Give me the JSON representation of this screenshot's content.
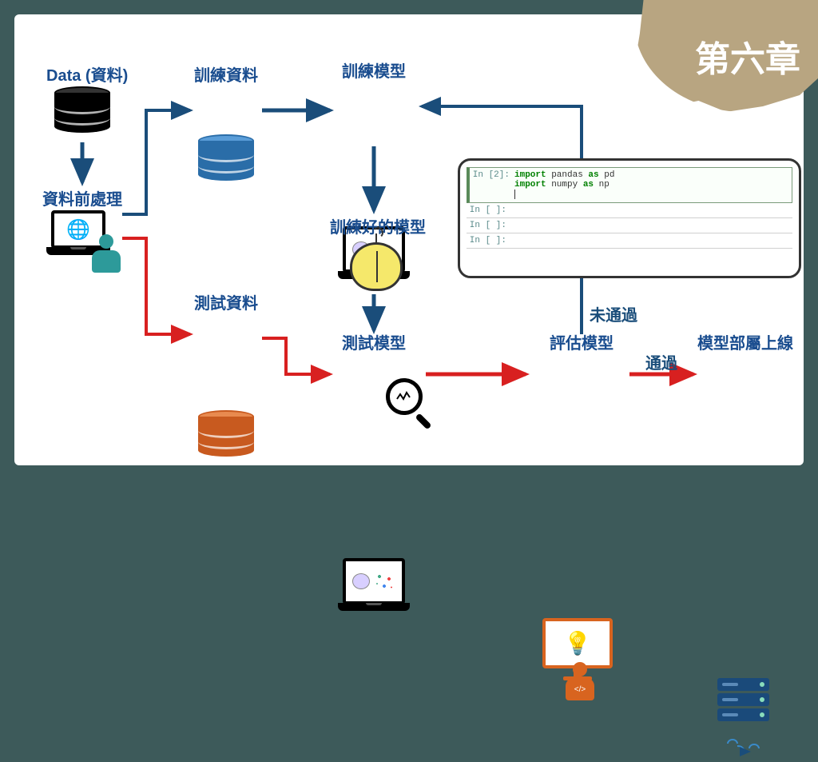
{
  "chapter": "第六章",
  "nodes": {
    "data": "Data (資料)",
    "preprocess": "資料前處理",
    "train_data": "訓練資料",
    "test_data": "測試資料",
    "train_model": "訓練模型",
    "trained_model": "訓練好的模型",
    "test_model": "測試模型",
    "eval_model": "評估模型",
    "deploy": "模型部屬上線"
  },
  "edges": {
    "not_pass": "未通過",
    "pass": "通過"
  },
  "code": {
    "cells": [
      {
        "prompt": "In [2]:",
        "lines": [
          "import pandas as pd",
          "import numpy as np"
        ],
        "active": true
      },
      {
        "prompt": "In [ ]:",
        "lines": [
          ""
        ],
        "active": false
      },
      {
        "prompt": "In [ ]:",
        "lines": [
          ""
        ],
        "active": false
      },
      {
        "prompt": "In [ ]:",
        "lines": [
          ""
        ],
        "active": false
      }
    ],
    "keyword": "import"
  }
}
